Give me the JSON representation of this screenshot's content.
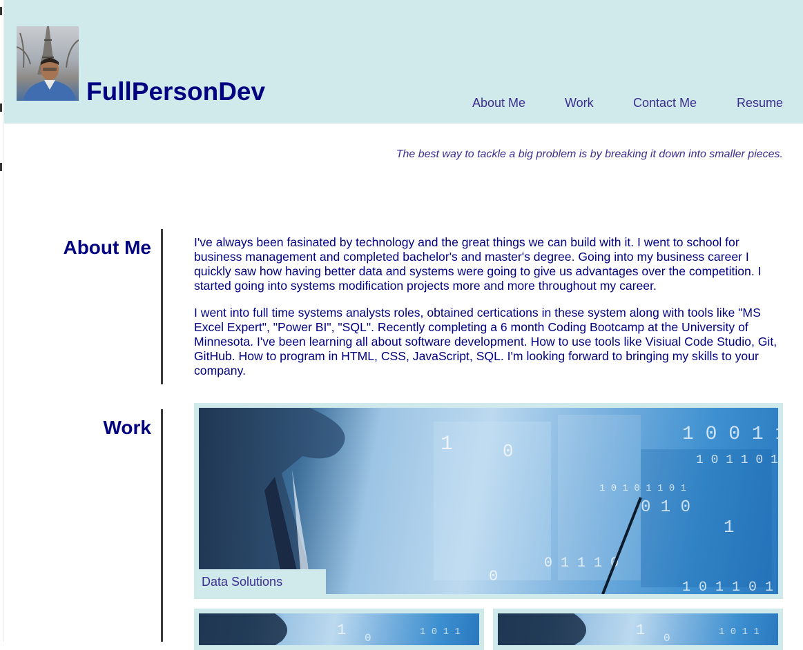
{
  "site": {
    "brand": "FullPersonDev"
  },
  "nav": {
    "items": [
      "About Me",
      "Work",
      "Contact Me",
      "Resume"
    ]
  },
  "tagline": "The best way to tackle a big problem is by breaking it down into smaller pieces.",
  "about": {
    "heading": "About Me",
    "paragraphs": [
      "I've always been fasinated by technology and the great things we can build with it. I went to school for business management and completed bachelor's and master's degree. Going into my business career I quickly saw how having better data and systems were going to give us advantages over the competition. I started going into systems modification projects more and more throughout my career.",
      "I went into full time systems analysts roles, obtained certications in these system along with tools like \"MS Excel Expert\", \"Power BI\", \"SQL\". Recently completing a 6 month Coding Bootcamp at the University of Minnesota. I've been learning all about software development. How to use tools like Visiual Code Studio, Git, GitHub. How to program in HTML, CSS, JavaScript, SQL. I'm looking forward to bringing my skills to your company."
    ]
  },
  "work": {
    "heading": "Work",
    "featured_caption": "Data Solutions"
  },
  "colors": {
    "header_bg": "#d0eaec",
    "brand": "#000080",
    "link": "#3b2e8f"
  }
}
